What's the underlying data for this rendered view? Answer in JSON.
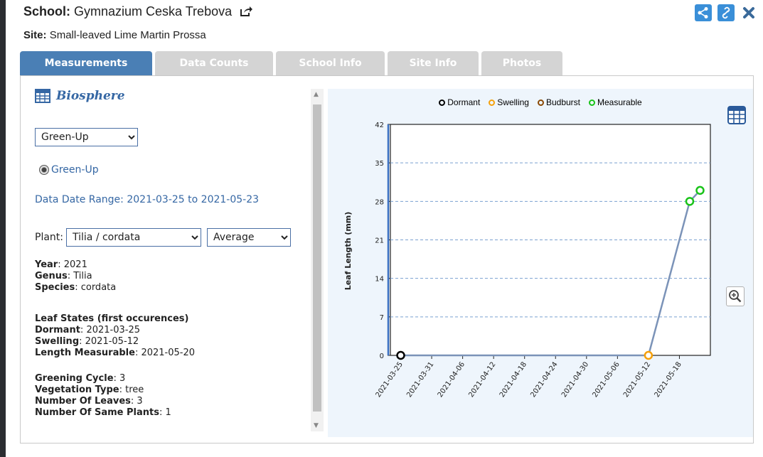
{
  "header": {
    "school_label": "School:",
    "school_name": "Gymnazium Ceska Trebova",
    "site_label": "Site:",
    "site_name": "Small-leaved Lime Martin Prossa"
  },
  "tabs": [
    "Measurements",
    "Data Counts",
    "School Info",
    "Site Info",
    "Photos"
  ],
  "left": {
    "protocol_title": "Biosphere",
    "protocol_select": "Green-Up",
    "radio_label": "Green-Up",
    "range_label": "Data Date Range:",
    "range_value": "2021-03-25 to 2021-05-23",
    "plant_label": "Plant:",
    "plant_select": "Tilia / cordata",
    "agg_select": "Average",
    "year_label": "Year",
    "year": "2021",
    "genus_label": "Genus",
    "genus": "Tilia",
    "species_label": "Species",
    "species": "cordata",
    "leaf_states_title": "Leaf States (first occurences)",
    "dormant_label": "Dormant",
    "dormant": "2021-03-25",
    "swelling_label": "Swelling",
    "swelling": "2021-05-12",
    "measurable_label": "Length Measurable",
    "measurable": "2021-05-20",
    "cycle_label": "Greening Cycle",
    "cycle": "3",
    "veg_label": "Vegetation Type",
    "veg": "tree",
    "leaves_label": "Number Of Leaves",
    "leaves": "3",
    "same_label": "Number Of Same Plants",
    "same": "1"
  },
  "colors": {
    "accent": "#4a7fb5",
    "dormant": "#000000",
    "swelling": "#f5a00a",
    "budburst": "#8b4a07",
    "measurable": "#18c318",
    "line": "#7b93b8"
  },
  "icons": [
    "external-link-icon",
    "share-icon",
    "link-icon",
    "close-icon",
    "table-icon",
    "zoom-in-icon"
  ],
  "chart_data": {
    "type": "line",
    "ylabel": "Leaf Length (mm)",
    "xlabel": "",
    "ylim": [
      0,
      42
    ],
    "yticks": [
      0,
      7,
      14,
      21,
      28,
      35,
      42
    ],
    "xticks": [
      "2021-03-25",
      "2021-03-31",
      "2021-04-06",
      "2021-04-12",
      "2021-04-18",
      "2021-04-24",
      "2021-04-30",
      "2021-05-06",
      "2021-05-12",
      "2021-05-18"
    ],
    "xlim": [
      "2021-03-23",
      "2021-05-24"
    ],
    "legend": [
      "Dormant",
      "Swelling",
      "Budburst",
      "Measurable"
    ],
    "legend_position": "top-center",
    "grid": "horizontal-dashed",
    "points": [
      {
        "x": "2021-03-25",
        "y": 0,
        "state": "Dormant"
      },
      {
        "x": "2021-05-12",
        "y": 0,
        "state": "Swelling"
      },
      {
        "x": "2021-05-20",
        "y": 28,
        "state": "Measurable"
      },
      {
        "x": "2021-05-22",
        "y": 30,
        "state": "Measurable"
      }
    ]
  }
}
